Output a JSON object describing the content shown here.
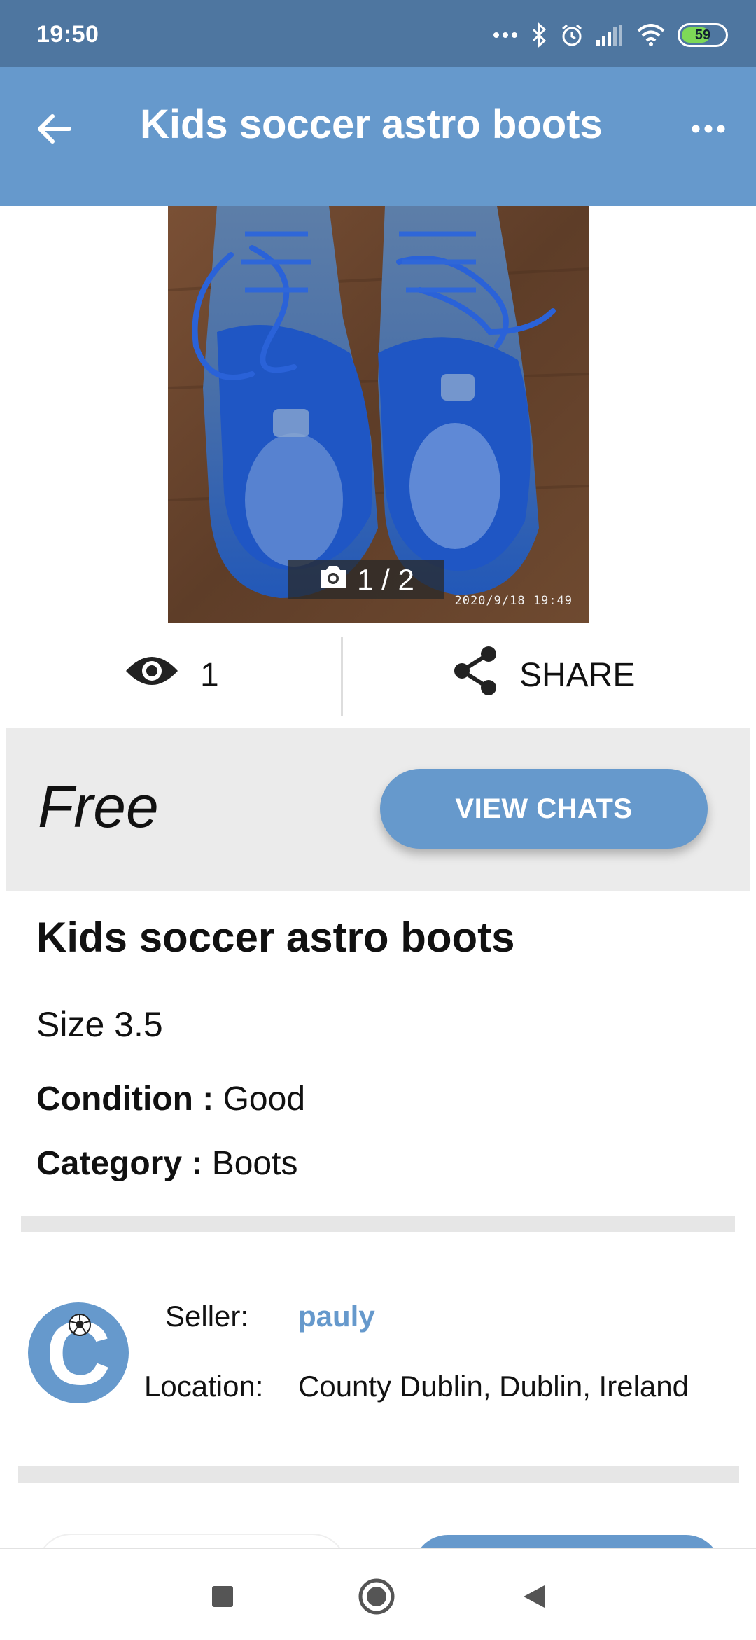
{
  "status_bar": {
    "time": "19:50",
    "battery_level": "59",
    "icons": [
      "more-dots-icon",
      "bluetooth-icon",
      "alarm-icon",
      "signal-icon",
      "wifi-icon",
      "battery-icon"
    ]
  },
  "app_bar": {
    "title": "Kids soccer astro boots",
    "back_icon": "arrow-back-icon",
    "more_icon": "more-horizontal-icon"
  },
  "photo": {
    "counter": "1 / 2",
    "timestamp": "2020/9/18  19:49",
    "subject": "blue soccer boots"
  },
  "stats": {
    "views": "1",
    "share_label": "SHARE"
  },
  "price_panel": {
    "price": "Free",
    "view_chats_label": "VIEW CHATS"
  },
  "item": {
    "title": "Kids soccer astro boots",
    "description": "Size 3.5",
    "condition_label": "Condition :",
    "condition_value": "Good",
    "category_label": "Category :",
    "category_value": "Boots"
  },
  "seller": {
    "avatar_letter": "C",
    "seller_label": "Seller:",
    "seller_name": "pauly",
    "location_label": "Location:",
    "location_value": "County Dublin, Dublin, Ireland"
  },
  "colors": {
    "status_bar": "#4e76a0",
    "accent": "#6699cc",
    "panel": "#ebebeb"
  }
}
